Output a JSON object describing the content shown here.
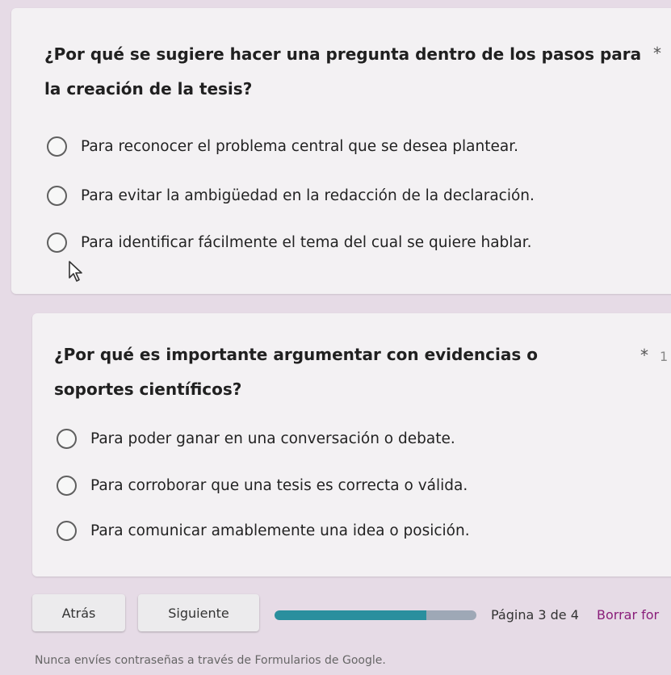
{
  "questions": [
    {
      "title": "¿Por qué se sugiere hacer una pregunta dentro de los pasos para la creación de la tesis?",
      "required_mark": "*",
      "options": [
        "Para reconocer el problema central que se desea plantear.",
        "Para evitar la ambigüedad en la redacción de la declaración.",
        "Para identificar fácilmente el tema del cual se quiere hablar."
      ]
    },
    {
      "title": "¿Por qué es importante argumentar con evidencias o soportes científicos?",
      "required_mark": "*",
      "required_tail": "1",
      "options": [
        "Para poder ganar en una conversación o debate.",
        "Para corroborar que una tesis es correcta o válida.",
        "Para comunicar amablemente una idea o posición."
      ]
    }
  ],
  "nav": {
    "back_label": "Atrás",
    "next_label": "Siguiente",
    "page_indicator": "Página 3 de 4",
    "clear_label": "Borrar for",
    "progress_fraction": 0.75
  },
  "footer": {
    "note": "Nunca envíes contraseñas a través de Formularios de Google."
  },
  "colors": {
    "page_background": "#e6dbe6",
    "card_background": "#f3f1f3",
    "progress_fill": "#2a8f9e",
    "progress_track": "#9ea8b6",
    "accent_link": "#8a1e7a"
  },
  "icons": {
    "cursor": "mouse-pointer-icon"
  }
}
